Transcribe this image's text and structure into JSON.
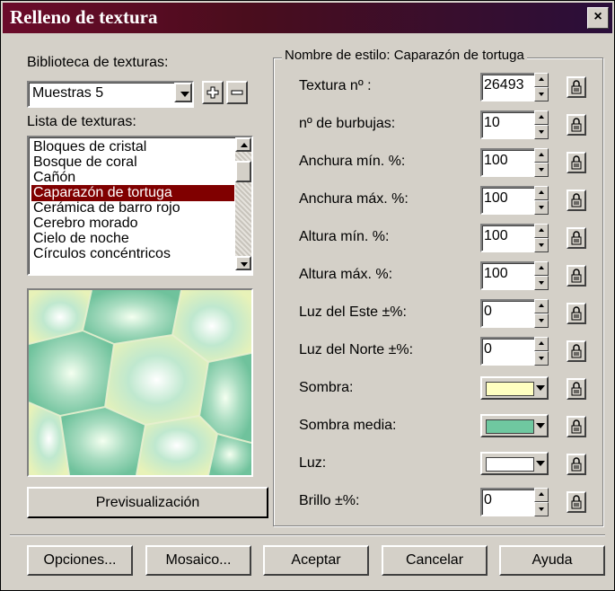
{
  "window": {
    "title": "Relleno de textura",
    "close": "×"
  },
  "library": {
    "label": "Biblioteca de texturas:",
    "selected": "Muestras 5"
  },
  "list": {
    "label": "Lista de texturas:",
    "items": [
      "Bloques de cristal",
      "Bosque de coral",
      "Cañón",
      "Caparazón de tortuga",
      "Cerámica de barro rojo",
      "Cerebro morado",
      "Cielo de noche",
      "Círculos concéntricos"
    ],
    "selected_index": 3
  },
  "preview_button": "Previsualización",
  "style_group": {
    "title": "Nombre de estilo: Caparazón de tortuga"
  },
  "params": [
    {
      "label": "Textura nº :",
      "value": "26493"
    },
    {
      "label": "nº de burbujas:",
      "value": "10"
    },
    {
      "label": "Anchura mín. %:",
      "value": "100"
    },
    {
      "label": "Anchura máx. %:",
      "value": "100"
    },
    {
      "label": "Altura mín. %:",
      "value": "100"
    },
    {
      "label": "Altura máx. %:",
      "value": "100"
    },
    {
      "label": "Luz del Este ±%:",
      "value": "0"
    },
    {
      "label": "Luz del Norte ±%:",
      "value": "0"
    }
  ],
  "colors": [
    {
      "label": "Sombra:",
      "color": "#ffffc0"
    },
    {
      "label": "Sombra media:",
      "color": "#6fc8a0"
    },
    {
      "label": "Luz:",
      "color": "#ffffff"
    }
  ],
  "brightness": {
    "label": "Brillo ±%:",
    "value": "0"
  },
  "buttons": {
    "options": "Opciones...",
    "tile": "Mosaico...",
    "ok": "Aceptar",
    "cancel": "Cancelar",
    "help": "Ayuda"
  }
}
